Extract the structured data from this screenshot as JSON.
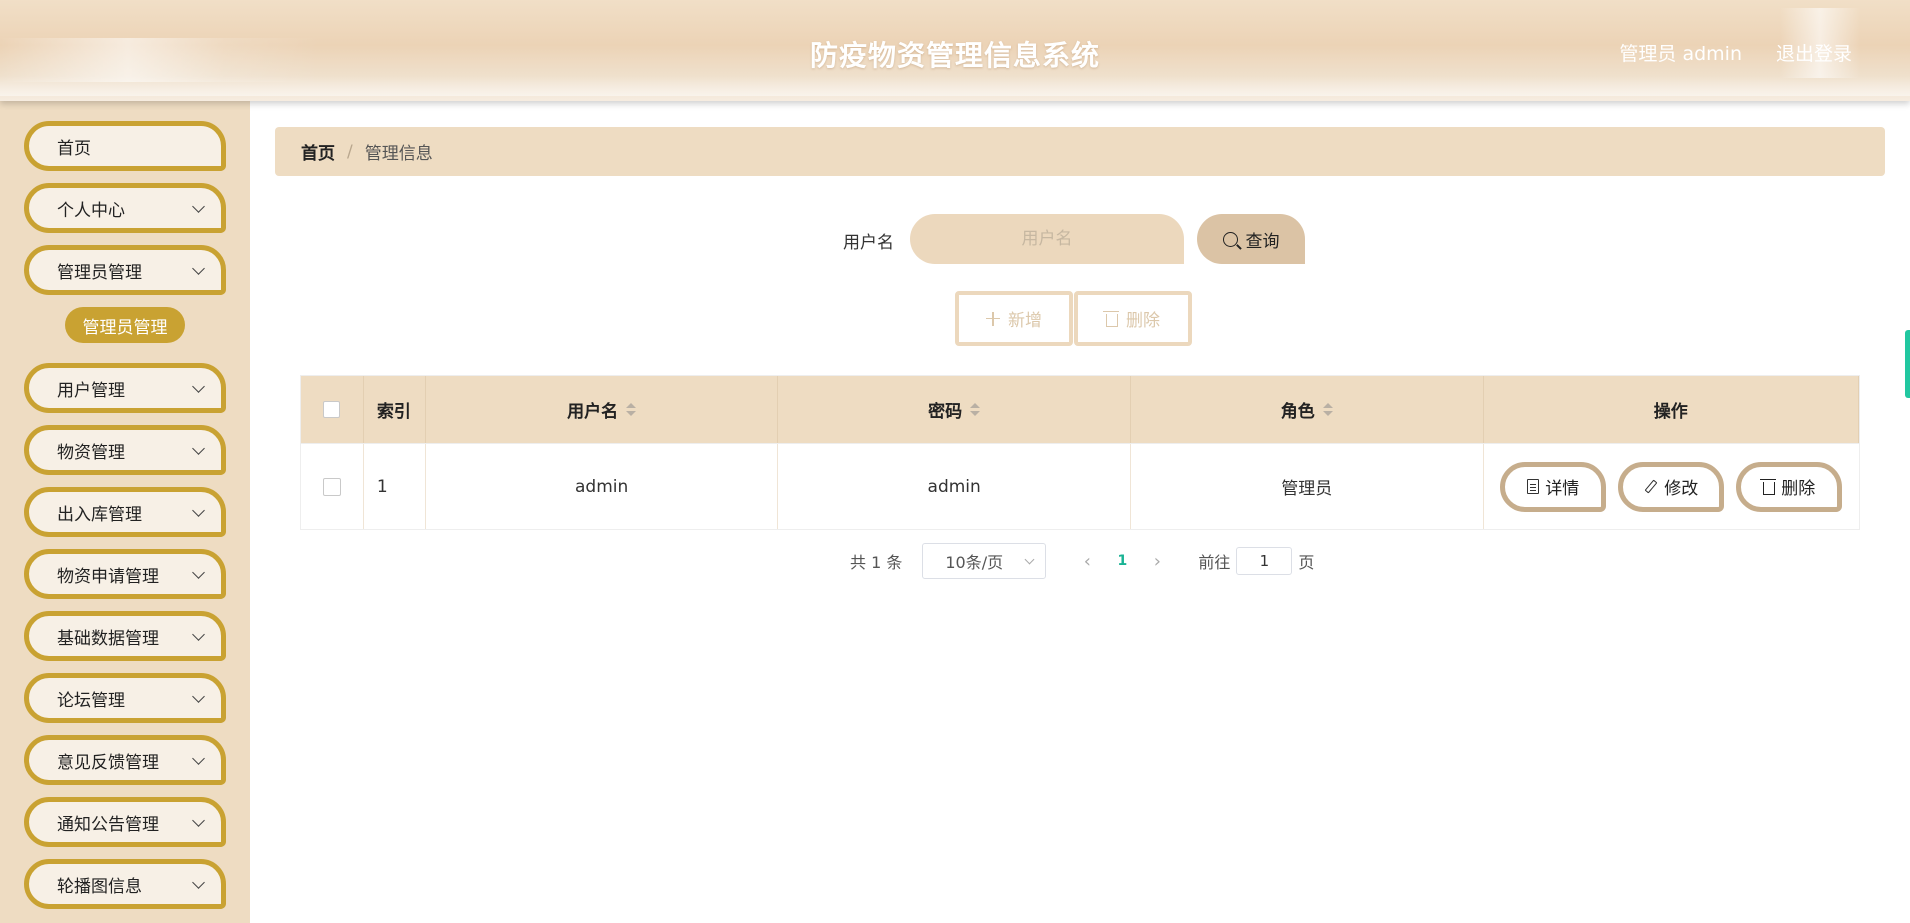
{
  "header": {
    "title": "防疫物资管理信息系统",
    "user_label": "管理员 admin",
    "logout_label": "退出登录"
  },
  "sidebar": {
    "items": [
      {
        "label": "首页"
      },
      {
        "label": "个人中心"
      },
      {
        "label": "管理员管理"
      },
      {
        "label": "用户管理"
      },
      {
        "label": "物资管理"
      },
      {
        "label": "出入库管理"
      },
      {
        "label": "物资申请管理"
      },
      {
        "label": "基础数据管理"
      },
      {
        "label": "论坛管理"
      },
      {
        "label": "意见反馈管理"
      },
      {
        "label": "通知公告管理"
      },
      {
        "label": "轮播图信息"
      }
    ],
    "active_sub_item": "管理员管理"
  },
  "breadcrumb": {
    "home": "首页",
    "separator": "/",
    "current": "管理信息"
  },
  "search": {
    "label": "用户名",
    "placeholder": "用户名",
    "value": "",
    "query_label": "查询"
  },
  "actions": {
    "add_label": "新增",
    "delete_label": "删除"
  },
  "table": {
    "columns": [
      "索引",
      "用户名",
      "密码",
      "角色",
      "操作"
    ],
    "rows": [
      {
        "index": "1",
        "username": "admin",
        "password": "admin",
        "role": "管理员"
      }
    ],
    "row_actions": {
      "detail": "详情",
      "edit": "修改",
      "delete": "删除"
    }
  },
  "pagination": {
    "total_text": "共 1 条",
    "page_size": "10条/页",
    "current_page": "1",
    "goto_label": "前往",
    "goto_value": "1",
    "page_suffix": "页"
  },
  "colors": {
    "accent": "#c9a232",
    "header_bg": "#ecd3b6",
    "sidebar_bg": "#eedcc2",
    "pager_active": "#19b394"
  }
}
